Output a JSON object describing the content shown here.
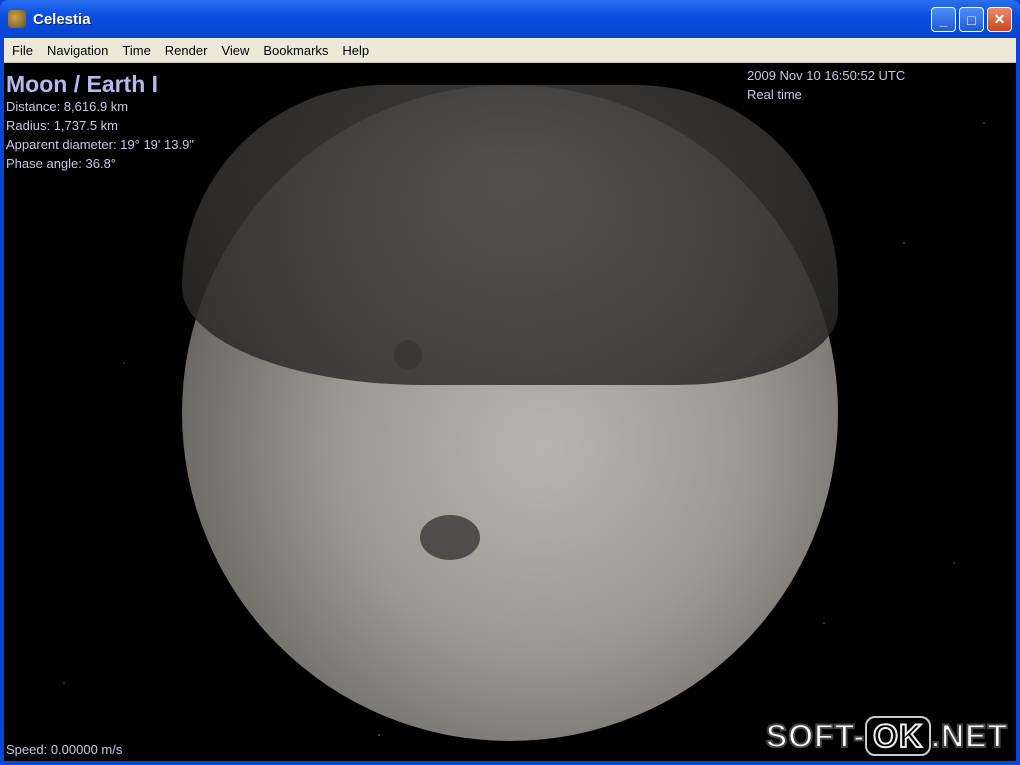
{
  "window": {
    "title": "Celestia",
    "minimize_icon": "minimize-icon",
    "maximize_icon": "maximize-icon",
    "close_icon": "close-icon"
  },
  "menu": [
    "File",
    "Navigation",
    "Time",
    "Render",
    "View",
    "Bookmarks",
    "Help"
  ],
  "object_info": {
    "name": "Moon / Earth I",
    "distance": "Distance: 8,616.9 km",
    "radius": "Radius: 1,737.5 km",
    "apparent_diameter": "Apparent diameter: 19° 19' 13.9\"",
    "phase_angle": "Phase angle: 36.8°"
  },
  "time_info": {
    "datetime": "2009 Nov 10 16:50:52 UTC",
    "rate": "Real time"
  },
  "speed": "Speed: 0.00000 m/s",
  "watermark": {
    "left": "SOFT-",
    "middle": "OK",
    "right": ".NET"
  }
}
